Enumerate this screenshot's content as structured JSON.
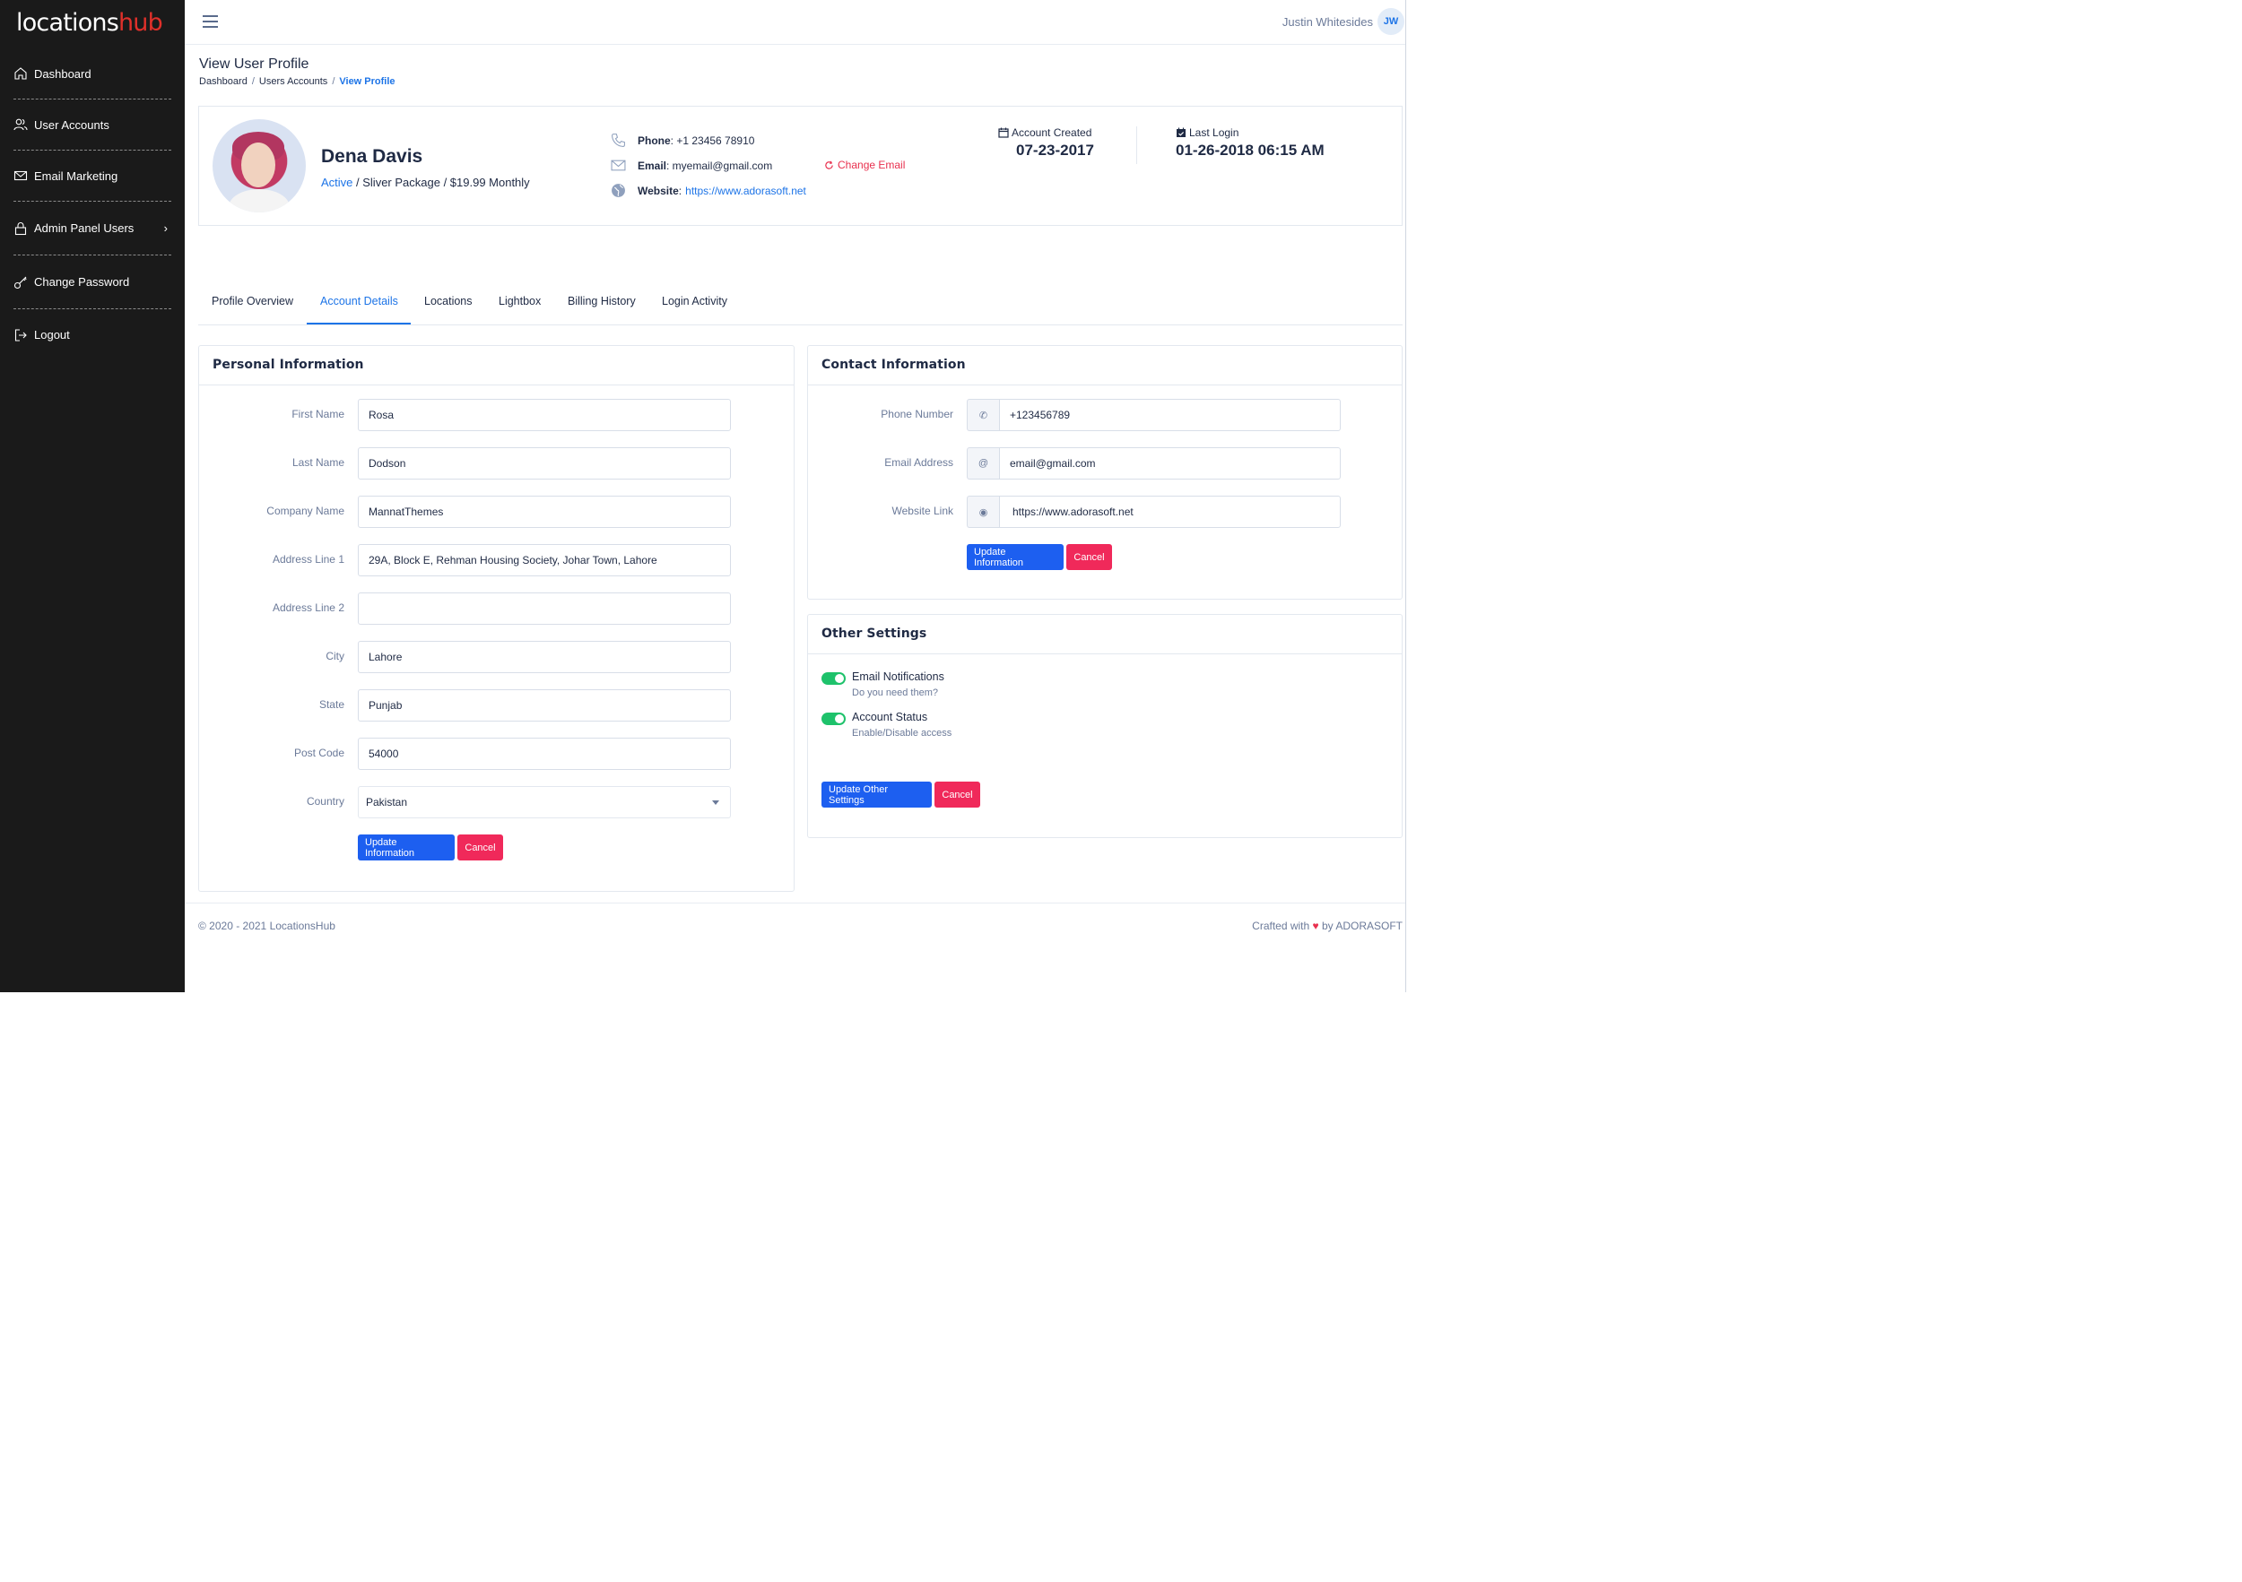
{
  "brand": {
    "part1": "locations",
    "part2": "hub"
  },
  "sidebar": {
    "items": [
      {
        "label": "Dashboard",
        "icon": "home-icon"
      },
      {
        "label": "User Accounts",
        "icon": "users-icon"
      },
      {
        "label": "Email Marketing",
        "icon": "mail-icon"
      },
      {
        "label": "Admin Panel Users",
        "icon": "lock-icon",
        "chevron": "›"
      },
      {
        "label": "Change Password",
        "icon": "key-icon"
      },
      {
        "label": "Logout",
        "icon": "logout-icon"
      }
    ]
  },
  "topbar": {
    "user_name": "Justin Whitesides",
    "user_initials": "JW"
  },
  "page": {
    "title": "View User Profile",
    "breadcrumb": [
      "Dashboard",
      "Users Accounts",
      "View Profile"
    ],
    "breadcrumb_sep": "/"
  },
  "profile": {
    "name": "Dena Davis",
    "status": "Active",
    "package": " / Sliver Package / $19.99 Monthly",
    "phone_label": "Phone",
    "phone_value": " : +1 23456 78910",
    "email_label": "Email",
    "email_value": " : myemail@gmail.com",
    "website_label": "Website",
    "website_colon": " :",
    "website_value": "https://www.adorasoft.net",
    "change_email": "Change Email",
    "account_created_label": "Account Created",
    "account_created_value": "07-23-2017",
    "last_login_label": "Last Login",
    "last_login_value": "01-26-2018 06:15 AM"
  },
  "tabs": [
    "Profile Overview",
    "Account Details",
    "Locations",
    "Lightbox",
    "Billing History",
    "Login Activity"
  ],
  "active_tab": "Account Details",
  "personal": {
    "title": "Personal Information",
    "fields": [
      {
        "label": "First Name",
        "value": "Rosa"
      },
      {
        "label": "Last Name",
        "value": "Dodson"
      },
      {
        "label": "Company Name",
        "value": "MannatThemes"
      },
      {
        "label": "Address Line 1",
        "value": "29A, Block E, Rehman Housing Society, Johar Town, Lahore"
      },
      {
        "label": "Address Line 2",
        "value": ""
      },
      {
        "label": "City",
        "value": "Lahore"
      },
      {
        "label": "State",
        "value": "Punjab"
      },
      {
        "label": "Post Code",
        "value": "54000"
      },
      {
        "label": "Country",
        "value": "Pakistan"
      }
    ],
    "update_label": "Update Information",
    "cancel_label": "Cancel"
  },
  "contact": {
    "title": "Contact Information",
    "fields": [
      {
        "label": "Phone Number",
        "value": "+123456789",
        "addon": "✆"
      },
      {
        "label": "Email Address",
        "value": "email@gmail.com",
        "addon": "@"
      },
      {
        "label": "Website Link",
        "value": "https://www.adorasoft.net",
        "addon": "◉"
      }
    ],
    "update_label": "Update Information",
    "cancel_label": "Cancel"
  },
  "other": {
    "title": "Other Settings",
    "toggles": [
      {
        "label": "Email Notifications",
        "sub": "Do you need them?",
        "on": true
      },
      {
        "label": "Account Status",
        "sub": "Enable/Disable access",
        "on": true
      }
    ],
    "update_label": "Update Other Settings",
    "cancel_label": "Cancel"
  },
  "footer": {
    "left": "© 2020 - 2021 LocationsHub",
    "right_pre": "Crafted with ",
    "heart": "♥",
    "right_post": " by ADORASOFT"
  },
  "colors": {
    "primary": "#1d5ff0",
    "danger": "#f0295a",
    "link": "#1d74e7",
    "toggle_on": "#1ec26b",
    "sidebar_bg": "#1a1a1a",
    "brand_red": "#e0302a"
  }
}
